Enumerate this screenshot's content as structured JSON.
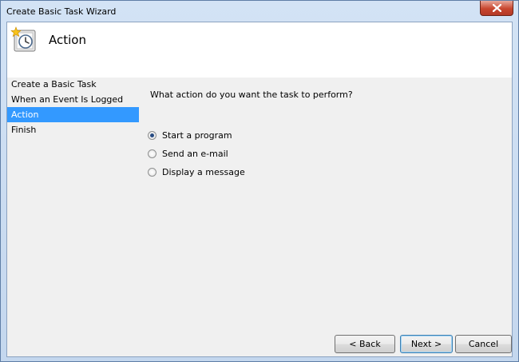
{
  "window": {
    "title": "Create Basic Task Wizard",
    "close_icon": "close-icon"
  },
  "header": {
    "title": "Action",
    "icon": "task-clock-icon"
  },
  "steps": [
    {
      "label": "Create a Basic Task",
      "active": false
    },
    {
      "label": "When an Event Is Logged",
      "active": false
    },
    {
      "label": "Action",
      "active": true
    },
    {
      "label": "Finish",
      "active": false
    }
  ],
  "main": {
    "question": "What action do you want the task to perform?",
    "options": [
      {
        "label": "Start a program",
        "mnemonic": "S",
        "checked": true
      },
      {
        "label": "Send an e-mail",
        "mnemonic": "e",
        "checked": false
      },
      {
        "label": "Display a message",
        "mnemonic": "m",
        "checked": false
      }
    ]
  },
  "buttons": {
    "back": {
      "label": "< Back",
      "mnemonic": "B"
    },
    "next": {
      "label": "Next >",
      "mnemonic": "N"
    },
    "cancel": {
      "label": "Cancel"
    }
  },
  "colors": {
    "selected_step": "#3399ff",
    "frame": "#c4d7ee",
    "close_button": "#c8462f"
  }
}
